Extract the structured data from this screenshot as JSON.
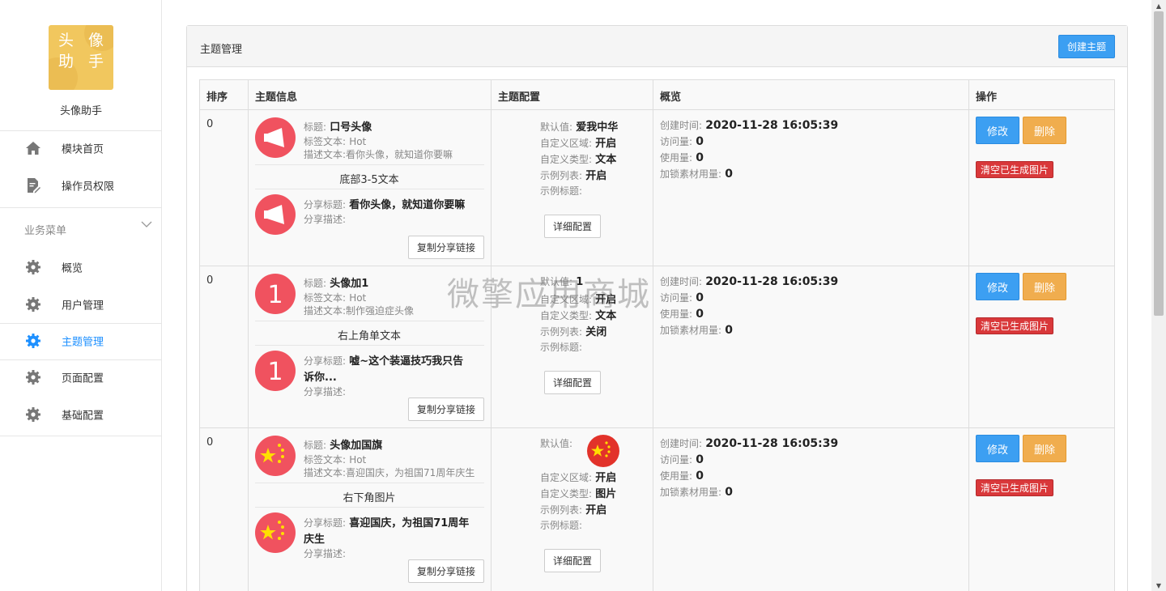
{
  "sidebar": {
    "logo_text": "头像\n助手",
    "app_name": "头像助手",
    "items_top": [
      {
        "label": "模块首页",
        "icon": "home-icon"
      },
      {
        "label": "操作员权限",
        "icon": "document-edit-icon"
      }
    ],
    "group_title": "业务菜单",
    "items": [
      {
        "label": "概览",
        "icon": "gear-icon"
      },
      {
        "label": "用户管理",
        "icon": "gear-icon"
      },
      {
        "label": "主题管理",
        "icon": "gear-icon",
        "active": true
      },
      {
        "label": "页面配置",
        "icon": "gear-icon"
      },
      {
        "label": "基础配置",
        "icon": "gear-icon"
      }
    ]
  },
  "card": {
    "title": "主题管理",
    "create_button": "创建主题"
  },
  "table": {
    "headers": [
      "排序",
      "主题信息",
      "主题配置",
      "概览",
      "操作"
    ],
    "rows": [
      {
        "sort": "0",
        "avatar": "megaphone",
        "title_label": "标题:",
        "title": "口号头像",
        "tag_label": "标签文本:",
        "tag": "Hot",
        "desc_label": "描述文本:",
        "desc": "看你头像，就知道你要嘛",
        "bottom_text": "底部3-5文本",
        "share_title_label": "分享标题:",
        "share_title": "看你头像，就知道你要嘛",
        "share_desc_label": "分享描述:",
        "copy_button": "复制分享链接",
        "config": {
          "default_label": "默认值:",
          "default": "爱我中华",
          "area_label": "自定义区域:",
          "area": "开启",
          "type_label": "自定义类型:",
          "type": "文本",
          "list_label": "示例列表:",
          "list": "开启",
          "example_title_label": "示例标题:"
        },
        "detail_button": "详细配置",
        "overview": {
          "created_label": "创建时间:",
          "created": "2020-11-28 16:05:39",
          "visits_label": "访问量:",
          "visits": "0",
          "usage_label": "使用量:",
          "usage": "0",
          "lock_label": "加锁素材用量:",
          "lock": "0"
        },
        "actions": {
          "edit": "修改",
          "delete": "删除",
          "clear": "清空已生成图片"
        }
      },
      {
        "sort": "0",
        "avatar": "number-one",
        "title_label": "标题:",
        "title": "头像加1",
        "tag_label": "标签文本:",
        "tag": "Hot",
        "desc_label": "描述文本:",
        "desc": "制作强迫症头像",
        "bottom_text": "右上角单文本",
        "share_title_label": "分享标题:",
        "share_title_1": "嘘~这个装逼技巧我只告",
        "share_title_2": "诉你...",
        "share_desc_label": "分享描述:",
        "copy_button": "复制分享链接",
        "config": {
          "default_label": "默认值:",
          "default": "1",
          "area_label": "自定义区域:",
          "area": "开启",
          "type_label": "自定义类型:",
          "type": "文本",
          "list_label": "示例列表:",
          "list": "关闭",
          "example_title_label": "示例标题:"
        },
        "detail_button": "详细配置",
        "overview": {
          "created_label": "创建时间:",
          "created": "2020-11-28 16:05:39",
          "visits_label": "访问量:",
          "visits": "0",
          "usage_label": "使用量:",
          "usage": "0",
          "lock_label": "加锁素材用量:",
          "lock": "0"
        },
        "actions": {
          "edit": "修改",
          "delete": "删除",
          "clear": "清空已生成图片"
        }
      },
      {
        "sort": "0",
        "avatar": "china-flag",
        "title_label": "标题:",
        "title": "头像加国旗",
        "tag_label": "标签文本:",
        "tag": "Hot",
        "desc_label": "描述文本:",
        "desc": "喜迎国庆，为祖国71周年庆生",
        "bottom_text": "右下角图片",
        "share_title_label": "分享标题:",
        "share_title_1": "喜迎国庆，为祖国71周年",
        "share_title_2": "庆生",
        "share_desc_label": "分享描述:",
        "copy_button": "复制分享链接",
        "config": {
          "default_label": "默认值:",
          "area_label": "自定义区域:",
          "area": "开启",
          "type_label": "自定义类型:",
          "type": "图片",
          "list_label": "示例列表:",
          "list": "开启",
          "example_title_label": "示例标题:"
        },
        "detail_button": "详细配置",
        "overview": {
          "created_label": "创建时间:",
          "created": "2020-11-28 16:05:39",
          "visits_label": "访问量:",
          "visits": "0",
          "usage_label": "使用量:",
          "usage": "0",
          "lock_label": "加锁素材用量:",
          "lock": "0"
        },
        "actions": {
          "edit": "修改",
          "delete": "删除",
          "clear": "清空已生成图片"
        }
      }
    ]
  },
  "watermark": "微擎应用商城",
  "colors": {
    "primary": "#3c9ff2",
    "warning": "#f0ad4e",
    "danger": "#d9383a",
    "avatar_red": "#f0525f",
    "logo": "#f1c75e"
  }
}
